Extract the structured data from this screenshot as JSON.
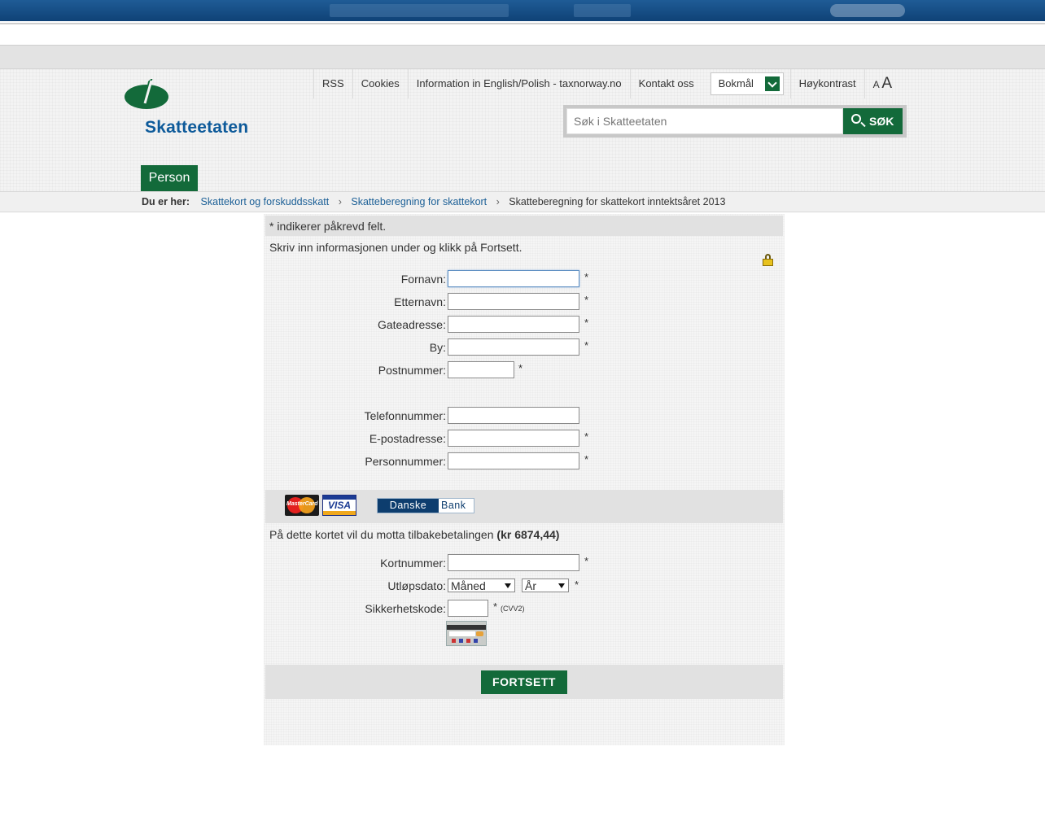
{
  "header": {
    "logo_text": "Skatteetaten",
    "nav": [
      "RSS",
      "Cookies",
      "Information in English/Polish - taxnorway.no",
      "Kontakt oss"
    ],
    "language_selected": "Bokmål",
    "contrast": "Høykontrast",
    "font_small": "A",
    "font_large": "A",
    "search_placeholder": "Søk i Skatteetaten",
    "search_button": "SØK",
    "tab": "Person"
  },
  "breadcrumb": {
    "label": "Du er her:",
    "items": [
      "Skattekort og forskuddsskatt",
      "Skatteberegning for skattekort"
    ],
    "current": "Skatteberegning for skattekort inntektsåret 2013"
  },
  "form": {
    "required_note": "* indikerer påkrevd felt.",
    "instruction": "Skriv inn informasjonen under og klikk på Fortsett.",
    "fields": {
      "fornavn": "Fornavn:",
      "etternavn": "Etternavn:",
      "gateadresse": "Gateadresse:",
      "by": "By:",
      "postnummer": "Postnummer:",
      "telefon": "Telefonnummer:",
      "epost": "E-postadresse:",
      "personnummer": "Personnummer:"
    },
    "star": "*",
    "cards": {
      "mastercard": "MasterCard",
      "visa": "VISA",
      "danske_a": "Danske",
      "danske_b": "Bank"
    },
    "refund_text": "På dette kortet vil du motta tilbakebetalingen",
    "refund_amount": "(kr 6874,44)",
    "card_fields": {
      "kortnummer": "Kortnummer:",
      "utlopsdato": "Utløpsdato:",
      "month_selected": "Måned",
      "year_selected": "År",
      "sikkerhetskode": "Sikkerhetskode:",
      "cvv_note": "(CVV2)"
    },
    "submit": "FORTSETT"
  }
}
